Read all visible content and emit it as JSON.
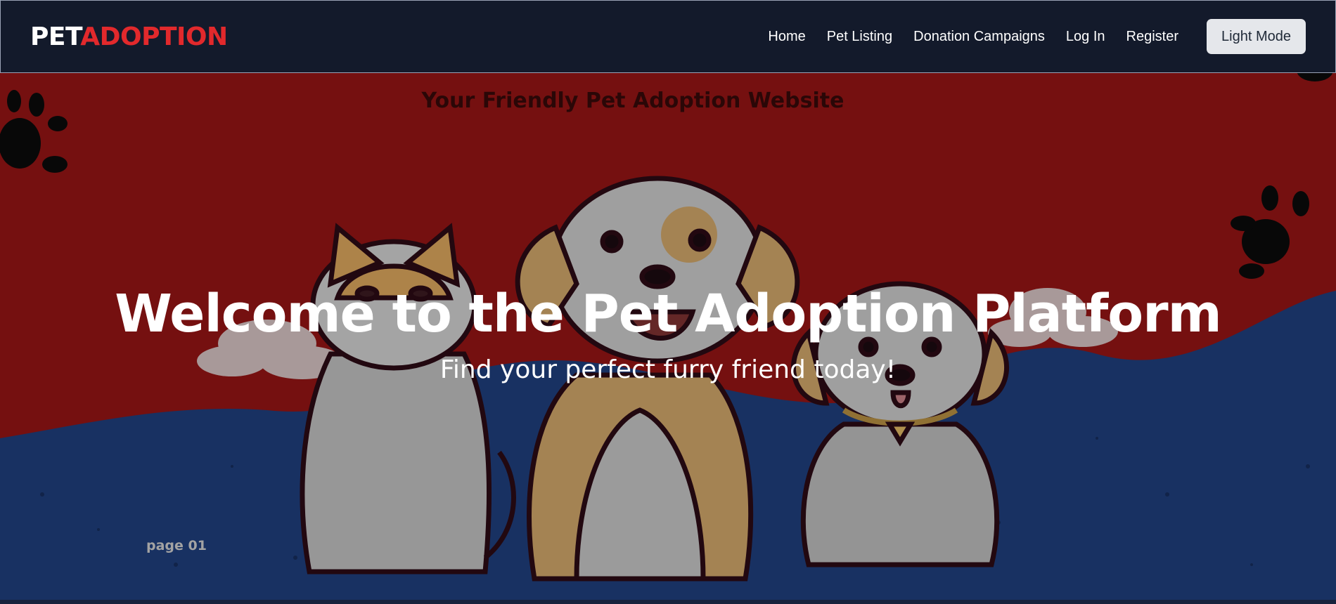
{
  "brand": {
    "part1": "PET",
    "part2": "ADOPTION"
  },
  "nav": {
    "links": [
      "Home",
      "Pet Listing",
      "Donation Campaigns",
      "Log In",
      "Register"
    ],
    "mode_button": "Light Mode"
  },
  "hero": {
    "tagline": "Your Friendly Pet Adoption Website",
    "title": "Welcome to the Pet Adoption Platform",
    "subtitle": "Find your perfect furry friend today!",
    "page_label": "page 01"
  },
  "colors": {
    "navbar_bg": "#131a2b",
    "brand_accent": "#e2292c",
    "hero_red": "#8f1414",
    "hero_blue": "#1e3c78",
    "button_bg": "#e5e7eb"
  }
}
